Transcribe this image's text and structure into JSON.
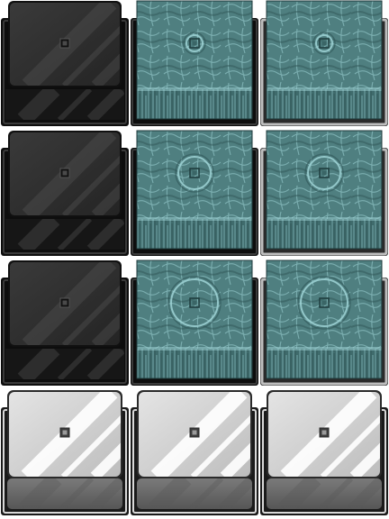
{
  "sheet": {
    "columns": 3,
    "rows": 4,
    "tiles": [
      {
        "row": 0,
        "col": 0,
        "style": "dark-glass",
        "ripple": "none"
      },
      {
        "row": 0,
        "col": 1,
        "style": "water",
        "ripple": "small",
        "frame": "dark"
      },
      {
        "row": 0,
        "col": 2,
        "style": "water",
        "ripple": "small",
        "frame": "light"
      },
      {
        "row": 1,
        "col": 0,
        "style": "dark-glass",
        "ripple": "none"
      },
      {
        "row": 1,
        "col": 1,
        "style": "water",
        "ripple": "medium",
        "frame": "dark"
      },
      {
        "row": 1,
        "col": 2,
        "style": "water",
        "ripple": "medium",
        "frame": "light"
      },
      {
        "row": 2,
        "col": 0,
        "style": "dark-glass",
        "ripple": "none"
      },
      {
        "row": 2,
        "col": 1,
        "style": "water",
        "ripple": "large",
        "frame": "dark"
      },
      {
        "row": 2,
        "col": 2,
        "style": "water",
        "ripple": "large",
        "frame": "light"
      },
      {
        "row": 3,
        "col": 0,
        "style": "light-glass",
        "ripple": "none"
      },
      {
        "row": 3,
        "col": 1,
        "style": "light-glass",
        "ripple": "none"
      },
      {
        "row": 3,
        "col": 2,
        "style": "light-glass",
        "ripple": "none"
      }
    ]
  },
  "colors": {
    "water_base": "#4f7f80",
    "water_dark": "#2f5556",
    "water_light": "#9fd4d6",
    "frame_dark": "#111111",
    "frame_light": "#d8d8d8",
    "glass_dark": "#2c2c2c",
    "glass_light": "#cfcfcf",
    "panel_light": "#6a6a6a"
  }
}
